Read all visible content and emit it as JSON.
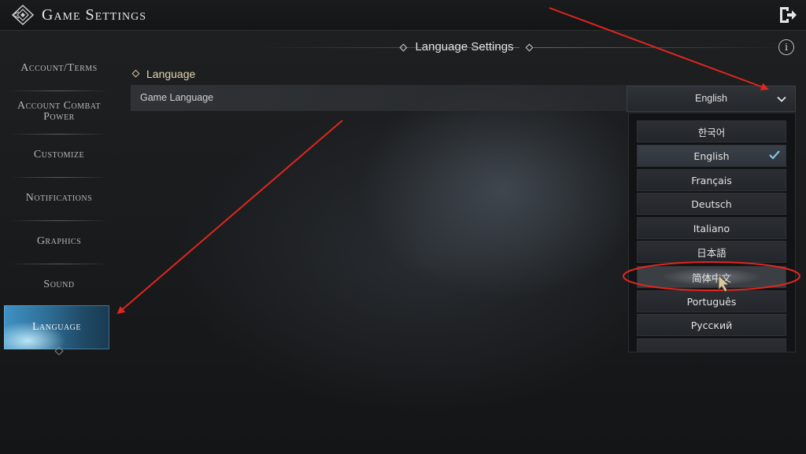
{
  "header": {
    "title": "Game Settings"
  },
  "section": {
    "title": "Language Settings"
  },
  "sidebar": {
    "items": [
      {
        "label": "Account/Terms"
      },
      {
        "label": "Account Combat Power"
      },
      {
        "label": "Customize"
      },
      {
        "label": "Notifications"
      },
      {
        "label": "Graphics"
      },
      {
        "label": "Sound"
      },
      {
        "label": "Language",
        "active": true
      }
    ]
  },
  "content": {
    "heading": "Language",
    "row_label": "Game Language",
    "selected_value": "English"
  },
  "dropdown": {
    "options": [
      {
        "label": "한국어"
      },
      {
        "label": "English",
        "selected": true
      },
      {
        "label": "Français"
      },
      {
        "label": "Deutsch"
      },
      {
        "label": "Italiano"
      },
      {
        "label": "日本語"
      },
      {
        "label": "简体中文",
        "hover": true
      },
      {
        "label": "Português"
      },
      {
        "label": "Русский"
      }
    ]
  },
  "icons": {
    "logo": "game-logo-icon",
    "exit": "exit-icon",
    "info": "info-icon",
    "chevron": "chevron-down-icon",
    "check": "checkmark-icon"
  },
  "colors": {
    "accent_active": "#3f93c4",
    "annotation_red": "#e0261f",
    "heading_gold": "#e6d6b0"
  },
  "info_glyph": "i"
}
